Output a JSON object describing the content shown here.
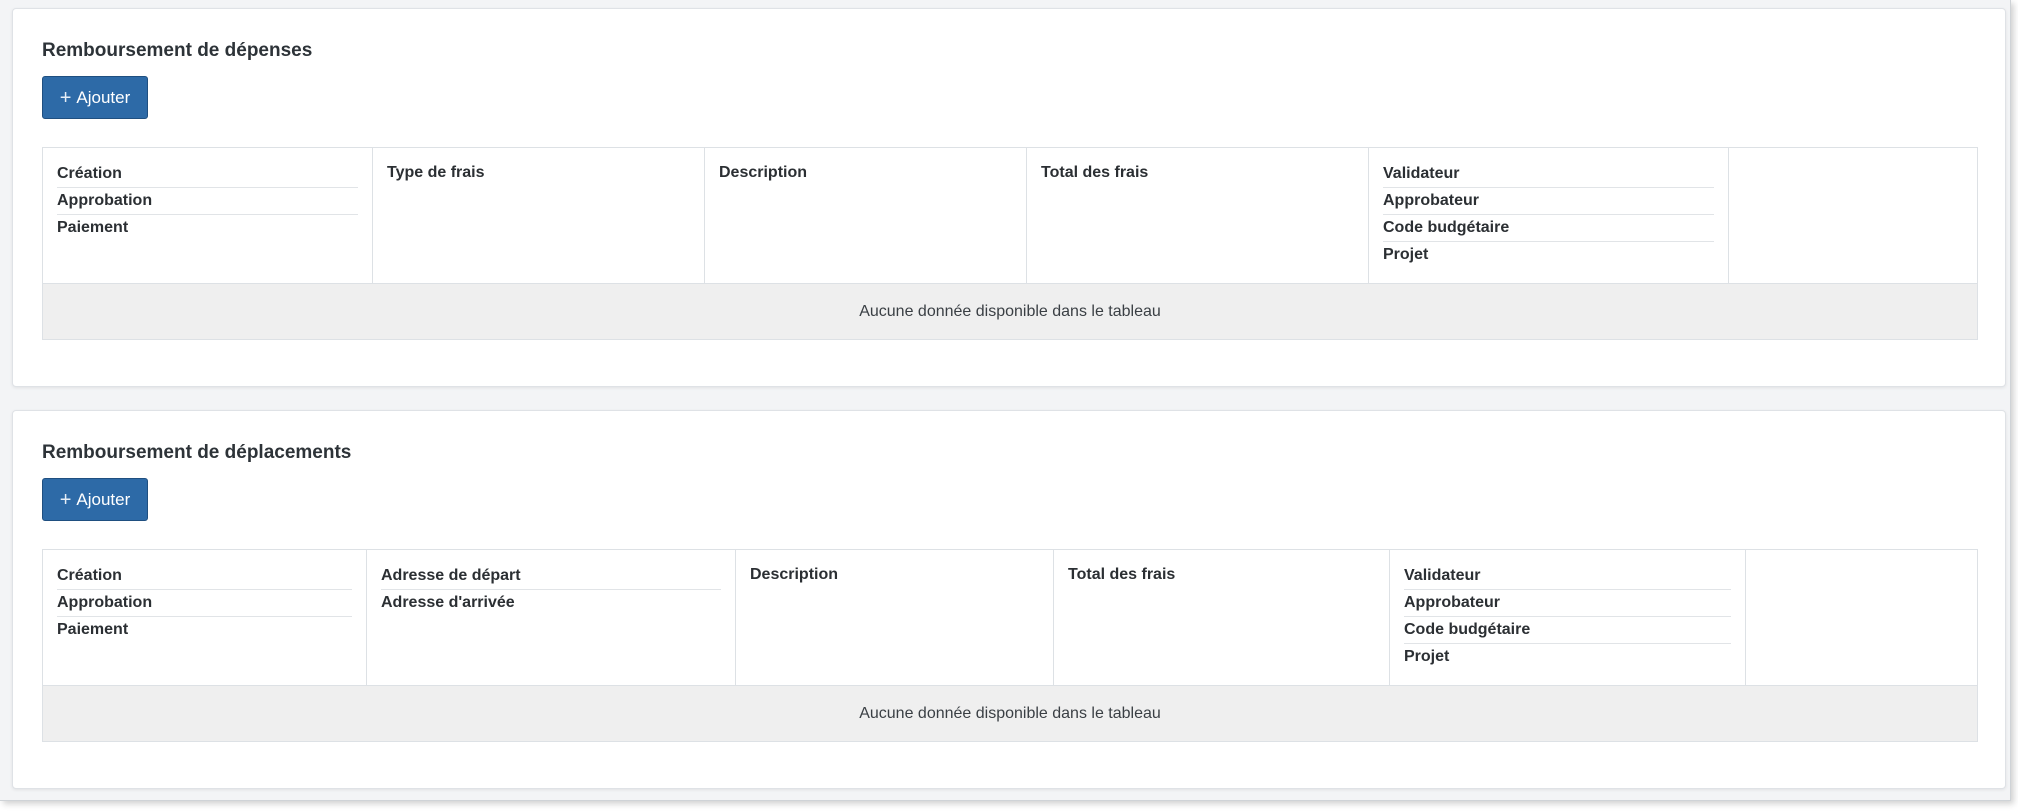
{
  "sections": [
    {
      "title": "Remboursement de dépenses",
      "add_label": "Ajouter",
      "columns": [
        [
          "Création",
          "Approbation",
          "Paiement"
        ],
        [
          "Type de frais"
        ],
        [
          "Description"
        ],
        [
          "Total des frais"
        ],
        [
          "Validateur",
          "Approbateur",
          "Code budgétaire",
          "Projet"
        ],
        []
      ],
      "empty_message": "Aucune donnée disponible dans le tableau"
    },
    {
      "title": "Remboursement de déplacements",
      "add_label": "Ajouter",
      "columns": [
        [
          "Création",
          "Approbation",
          "Paiement"
        ],
        [
          "Adresse de départ",
          "Adresse d'arrivée"
        ],
        [
          "Description"
        ],
        [
          "Total des frais"
        ],
        [
          "Validateur",
          "Approbateur",
          "Code budgétaire",
          "Projet"
        ],
        []
      ],
      "empty_message": "Aucune donnée disponible dans le tableau"
    }
  ],
  "icons": {
    "add": "plus-icon"
  },
  "colors": {
    "primary_button": "#2d6aa7",
    "empty_row_bg": "#efefef"
  }
}
